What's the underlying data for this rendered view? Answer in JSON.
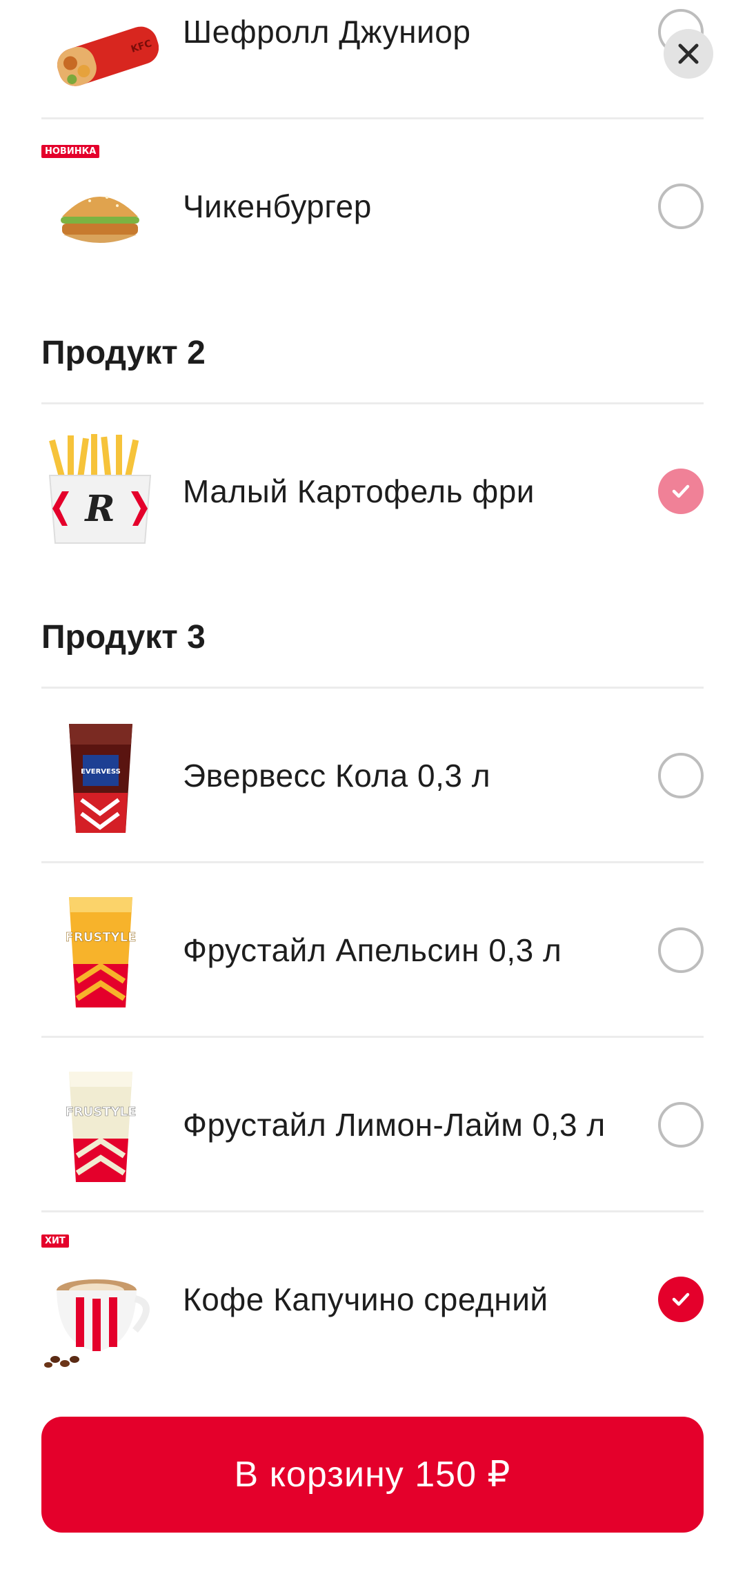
{
  "colors": {
    "accent": "#e4002b",
    "accent_soft": "#f08197",
    "separator": "#ececec",
    "radio_border": "#bdbdbd"
  },
  "close": {
    "icon": "close-icon"
  },
  "items_group1": [
    {
      "name": "Шефролл Джуниор",
      "badge": "",
      "selected": false,
      "icon": "chicken-roll-image"
    },
    {
      "name": "Чикенбургер",
      "badge": "НОВИНКА",
      "selected": false,
      "icon": "burger-image"
    }
  ],
  "section2": {
    "title": "Продукт 2"
  },
  "items_group2": [
    {
      "name": "Малый Картофель фри",
      "badge": "",
      "selected": true,
      "icon": "fries-image"
    }
  ],
  "section3": {
    "title": "Продукт 3"
  },
  "items_group3": [
    {
      "name": "Эвервесс Кола 0,3 л",
      "badge": "",
      "selected": false,
      "icon": "cola-cup-image"
    },
    {
      "name": "Фрустайл Апельсин 0,3 л",
      "badge": "",
      "selected": false,
      "icon": "orange-drink-image"
    },
    {
      "name": "Фрустайл Лимон-Лайм 0,3 л",
      "badge": "",
      "selected": false,
      "icon": "lemon-drink-image"
    },
    {
      "name": "Кофе Капучино средний",
      "badge": "ХИТ",
      "selected": true,
      "icon": "coffee-cup-image"
    }
  ],
  "cart_button": {
    "label": "В корзину 150 ₽"
  }
}
